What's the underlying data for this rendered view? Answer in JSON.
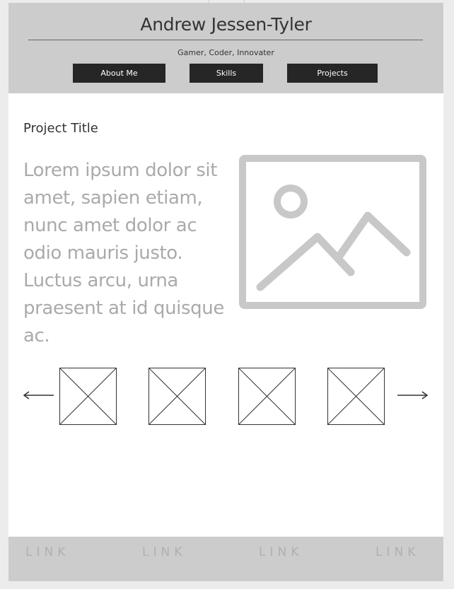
{
  "header": {
    "name": "Andrew Jessen-Tyler",
    "tagline": "Gamer, Coder, Innovater",
    "nav": [
      {
        "label": "About Me"
      },
      {
        "label": "Skills"
      },
      {
        "label": "Projects"
      }
    ]
  },
  "main": {
    "project_title": "Project Title",
    "description": "Lorem ipsum dolor sit amet, sapien etiam, nunc amet dolor ac odio mauris justo. Luctus arcu, urna praesent at id quisque ac.",
    "hero_icon": "image-placeholder-icon",
    "carousel": {
      "prev_icon": "arrow-left-icon",
      "next_icon": "arrow-right-icon",
      "thumbnail_count": 4
    }
  },
  "footer": {
    "links": [
      "LINK",
      "LINK",
      "LINK",
      "LINK"
    ]
  },
  "colors": {
    "header_bg": "#cccccc",
    "nav_button_bg": "#262626",
    "text_gray": "#aaaaaa",
    "placeholder_gray": "#c8c8c8"
  }
}
